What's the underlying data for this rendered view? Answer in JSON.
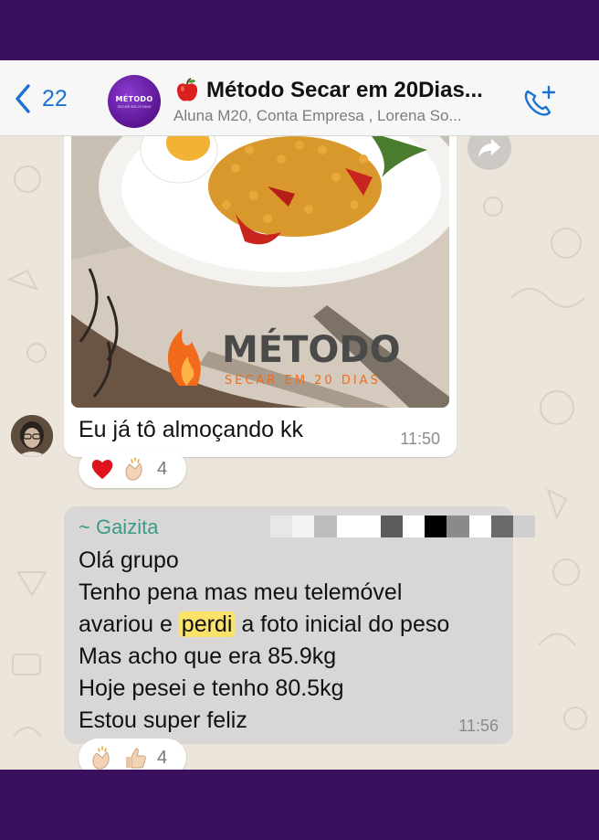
{
  "header": {
    "back_count": "22",
    "title": "Método Secar em 20Dias...",
    "subtitle": "Aluna M20, Conta Empresa , Lorena So...",
    "avatar_text": "MÉTODO",
    "avatar_subtext": "SECAR EM 20 DIAS"
  },
  "image_message": {
    "watermark_title": "MÉTODO",
    "watermark_subtitle": "SECAR EM 20 DIAS",
    "caption": "Eu já tô almoçando kk",
    "time": "11:50",
    "reactions": {
      "icons": [
        "red-heart-icon",
        "clapping-hands-icon"
      ],
      "count": "4"
    }
  },
  "text_message": {
    "sender": "~ Gaizita",
    "lines_before": [
      "Olá grupo",
      "Tenho pena mas meu telemóvel"
    ],
    "line3_start": "avariou e ",
    "line3_highlight": "perdi",
    "line3_end": " a foto inicial do peso",
    "lines_after": [
      "Mas acho que era 85.9kg",
      "Hoje pesei e tenho 80.5kg",
      "Estou super feliz"
    ],
    "time": "11:56",
    "reactions": {
      "icons": [
        "clapping-hands-icon",
        "thumbs-up-icon"
      ],
      "count": "4"
    }
  },
  "colors": {
    "brand_purple": "#3a0f5e",
    "ios_blue": "#1a73d1",
    "sender_name": "#3a9a8c",
    "highlight": "#fbe36a",
    "bubble_gray": "#d9d7d5"
  }
}
